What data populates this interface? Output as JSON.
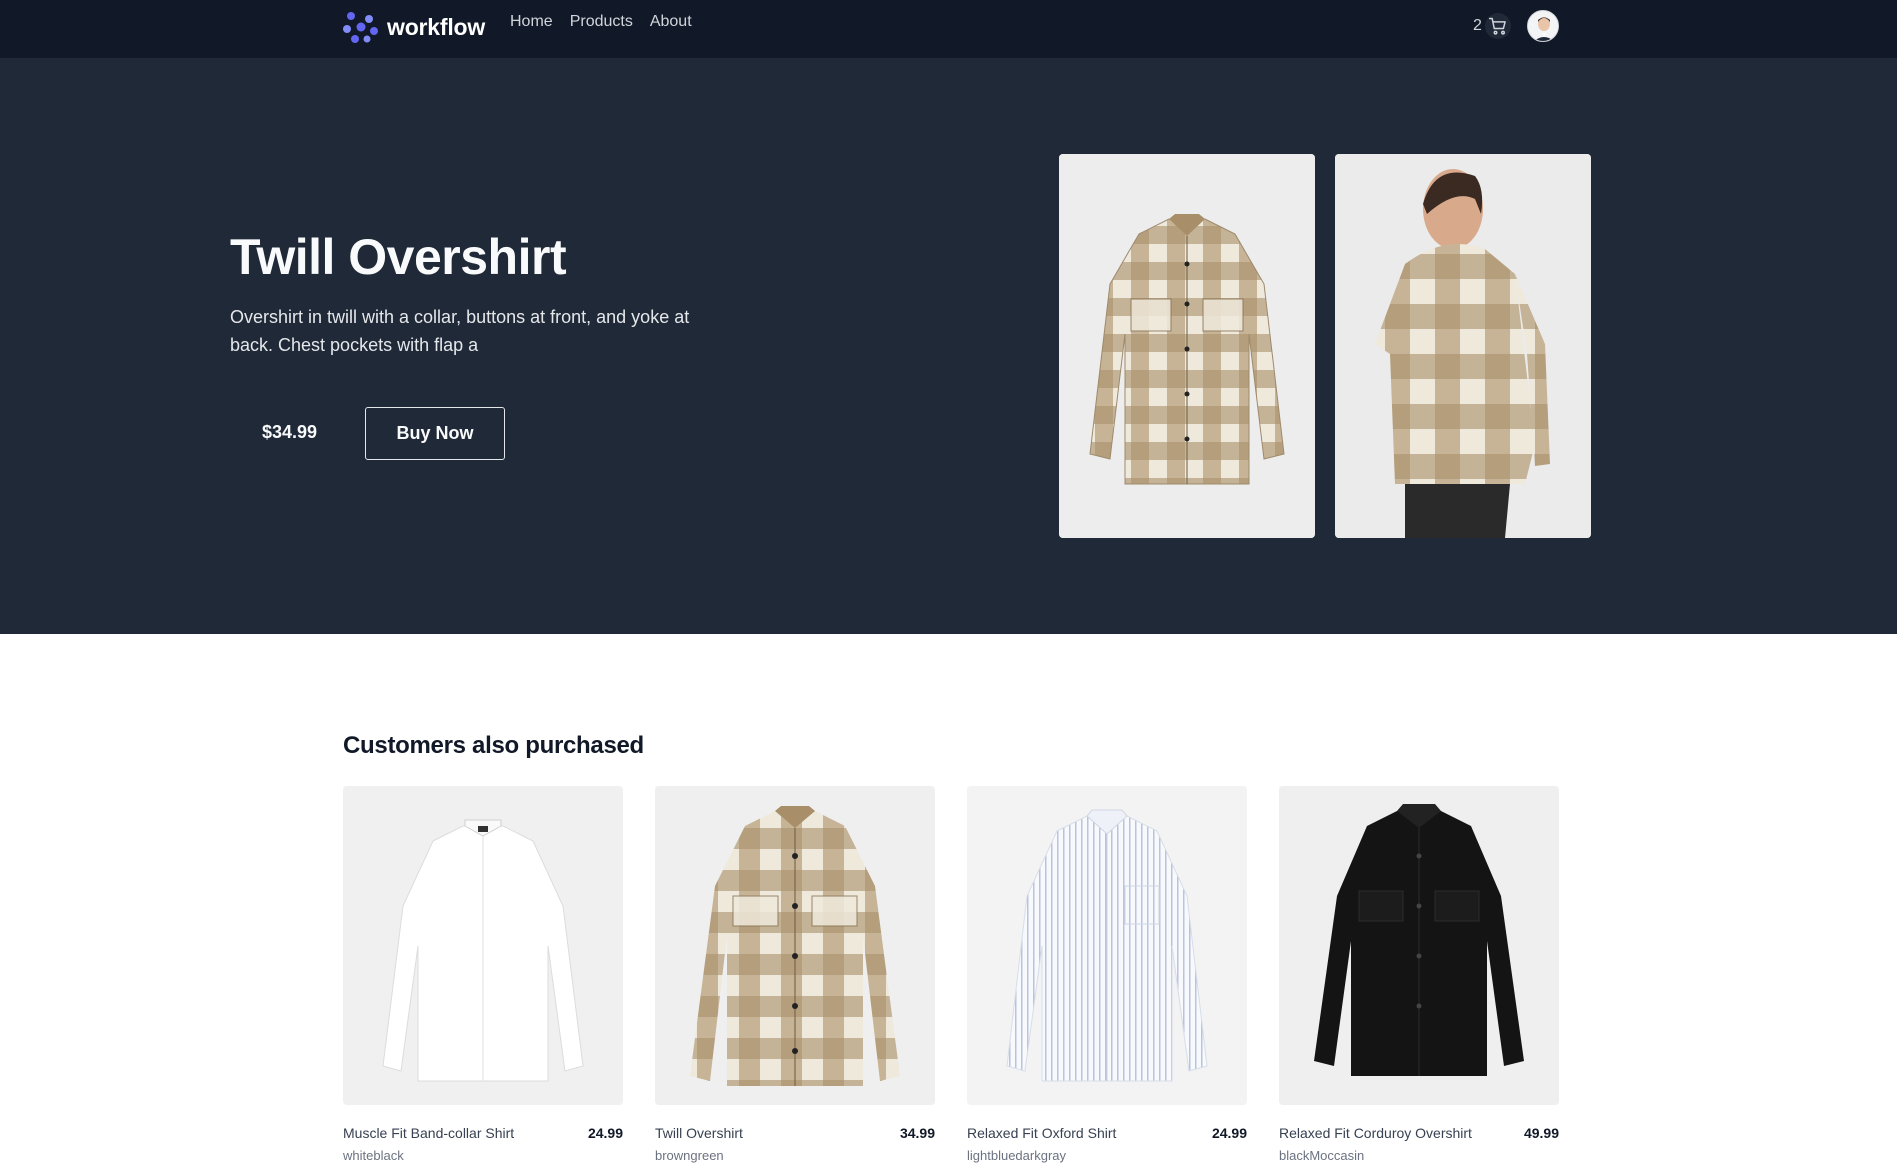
{
  "nav": {
    "brand": "workflow",
    "links": [
      "Home",
      "Products",
      "About"
    ],
    "cart_count": "2",
    "icons": {
      "brand": "workflow-logo-icon",
      "cart": "cart-icon",
      "avatar": "user-avatar"
    }
  },
  "hero": {
    "title": "Twill Overshirt",
    "description": "Overshirt in twill with a collar, buttons at front, and yoke at back. Chest pockets with flap a",
    "price": "$34.99",
    "buy_label": "Buy Now"
  },
  "related": {
    "title": "Customers also purchased",
    "products": [
      {
        "name": "Muscle Fit Band-collar Shirt",
        "price": "24.99",
        "color": "whiteblack"
      },
      {
        "name": "Twill Overshirt",
        "price": "34.99",
        "color": "browngreen"
      },
      {
        "name": "Relaxed Fit Oxford Shirt",
        "price": "24.99",
        "color": "lightbluedarkgray"
      },
      {
        "name": "Relaxed Fit Corduroy Overshirt",
        "price": "49.99",
        "color": "blackMoccasin"
      }
    ]
  },
  "colors": {
    "nav_bg": "#111827",
    "hero_bg": "#1f2937",
    "brand_accent": "#6366f1"
  }
}
